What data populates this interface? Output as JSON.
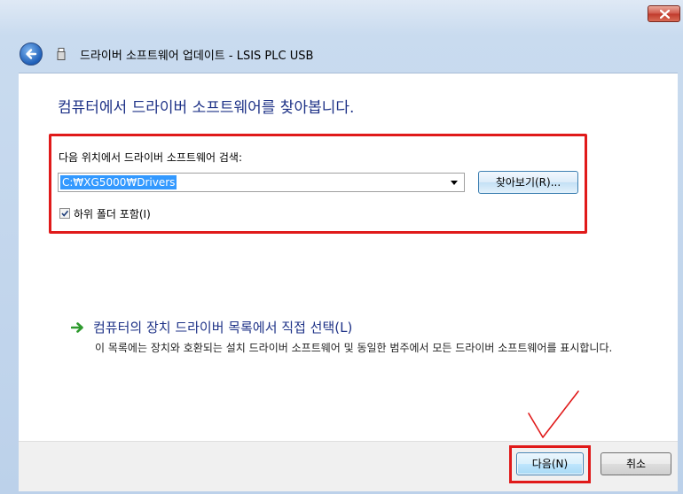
{
  "window": {
    "title": "드라이버 소프트웨어 업데이트 - LSIS PLC USB",
    "close_icon": "close-icon",
    "back_icon": "back-arrow-icon",
    "device_icon": "usb-device-icon"
  },
  "main": {
    "heading": "컴퓨터에서 드라이버 소프트웨어를 찾아봅니다.",
    "search": {
      "label": "다음 위치에서 드라이버 소프트웨어 검색:",
      "path_value": "C:₩XG5000₩Drivers",
      "browse_label": "찾아보기(R)...",
      "include_subfolders_label": "하위 폴더 포함(I)",
      "include_subfolders_checked": true
    },
    "pick_link": {
      "title": "컴퓨터의 장치 드라이버 목록에서 직접 선택(L)",
      "description": "이 목록에는 장치와 호환되는 설치 드라이버 소프트웨어 및 동일한 범주에서 모든 드라이버 소프트웨어를 표시합니다."
    }
  },
  "footer": {
    "next_label": "다음(N)",
    "cancel_label": "취소"
  },
  "colors": {
    "heading": "#1e3287",
    "highlight_red": "#e01a1a",
    "link_arrow": "#2e9a2e",
    "selection": "#3399ff"
  }
}
